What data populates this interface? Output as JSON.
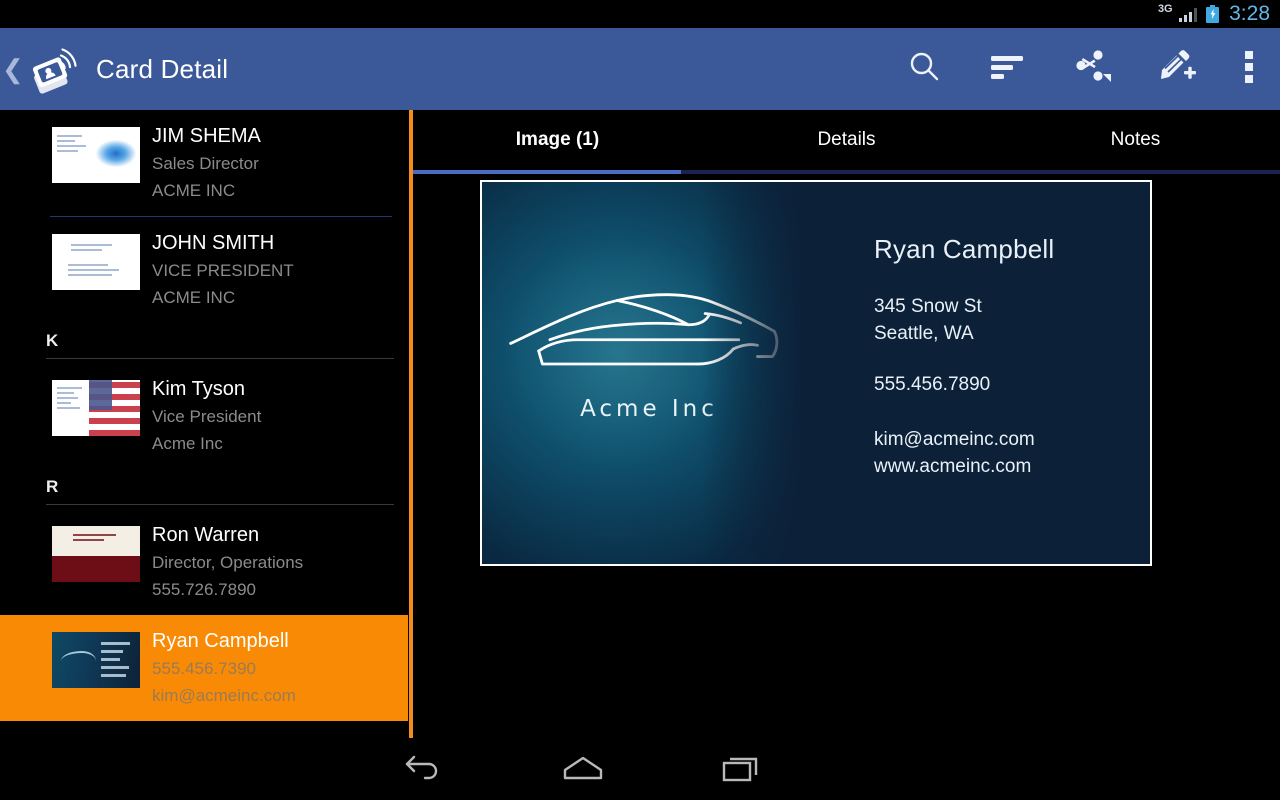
{
  "statusbar": {
    "network": "3G",
    "time": "3:28",
    "battery_icon": "battery-charging-icon",
    "signal_icon": "signal-bars-icon"
  },
  "appbar": {
    "back_icon": "back-chevron-icon",
    "logo_icon": "app-logo-cardscanner-icon",
    "title": "Card Detail",
    "actions": [
      {
        "name": "search-icon",
        "label": "Search"
      },
      {
        "name": "sort-icon",
        "label": "Sort"
      },
      {
        "name": "share-icon",
        "label": "Share"
      },
      {
        "name": "add-card-icon",
        "label": "Add Card"
      },
      {
        "name": "overflow-menu-icon",
        "label": "More options"
      }
    ],
    "bar_color": "#3b5898"
  },
  "sidebar": {
    "divider_color": "#f58b1f",
    "selected_color": "#f98a06",
    "entries": [
      {
        "type": "item",
        "name": "JIM SHEMA",
        "line2": "Sales Director",
        "line3": "ACME INC",
        "thumb": "card-thumb-water",
        "selected": false
      },
      {
        "type": "divider_blue"
      },
      {
        "type": "item",
        "name": "JOHN SMITH",
        "line2": "VICE PRESIDENT",
        "line3": "ACME INC",
        "thumb": "card-thumb-plain",
        "selected": false
      },
      {
        "type": "section",
        "letter": "K"
      },
      {
        "type": "item",
        "name": "Kim Tyson",
        "line2": "Vice President",
        "line3": "Acme Inc",
        "thumb": "card-thumb-flag",
        "selected": false
      },
      {
        "type": "section",
        "letter": "R"
      },
      {
        "type": "item",
        "name": "Ron Warren",
        "line2": "Director, Operations",
        "line3": "555.726.7890",
        "thumb": "card-thumb-maroon",
        "selected": false
      },
      {
        "type": "item",
        "name": "Ryan Campbell",
        "line2": "555.456.7390",
        "line3": "kim@acmeinc.com",
        "thumb": "card-thumb-blue",
        "selected": true
      }
    ]
  },
  "detail": {
    "tabs": [
      {
        "label": "Image (1)",
        "active": true
      },
      {
        "label": "Details",
        "active": false
      },
      {
        "label": "Notes",
        "active": false
      }
    ],
    "tab_indicator_color": "#4a6cc4",
    "card": {
      "logo_icon": "sports-car-outline-icon",
      "brand": "Acme Inc",
      "name": "Ryan Campbell",
      "address_line1": "345 Snow St",
      "address_line2": "Seattle, WA",
      "phone": "555.456.7890",
      "email": "kim@acmeinc.com",
      "website": "www.acmeinc.com",
      "background_color": "#0c2038",
      "accent_color": "#176b86"
    }
  },
  "navbar": {
    "back": "nav-back-icon",
    "home": "nav-home-icon",
    "recents": "nav-recents-icon"
  }
}
